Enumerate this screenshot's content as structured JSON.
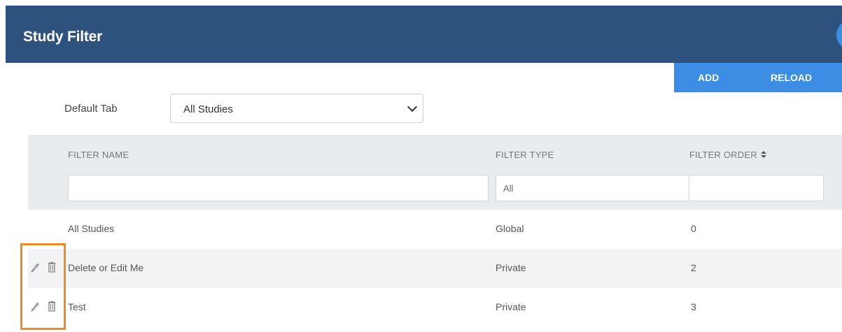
{
  "header": {
    "title": "Study Filter"
  },
  "actions": {
    "add_label": "ADD",
    "reload_label": "RELOAD"
  },
  "default_tab": {
    "label": "Default Tab",
    "selected": "All Studies"
  },
  "table": {
    "columns": [
      "FILTER NAME",
      "FILTER TYPE",
      "FILTER ORDER"
    ],
    "sort_column": "FILTER ORDER",
    "filters": {
      "name_value": "",
      "type_selected": "All",
      "order_value": ""
    },
    "rows": [
      {
        "name": "All Studies",
        "type": "Global",
        "order": "0",
        "editable": false
      },
      {
        "name": "Delete or Edit Me",
        "type": "Private",
        "order": "2",
        "editable": true
      },
      {
        "name": "Test",
        "type": "Private",
        "order": "3",
        "editable": true
      }
    ]
  },
  "icons": {
    "edit": "pencil-icon",
    "delete": "trash-icon",
    "sort": "sort-icon",
    "dropdown": "chevron-down-icon"
  },
  "colors": {
    "header_bg": "#2d527e",
    "action_bar_bg": "#3b8ee3",
    "highlight": "#f08a24"
  }
}
